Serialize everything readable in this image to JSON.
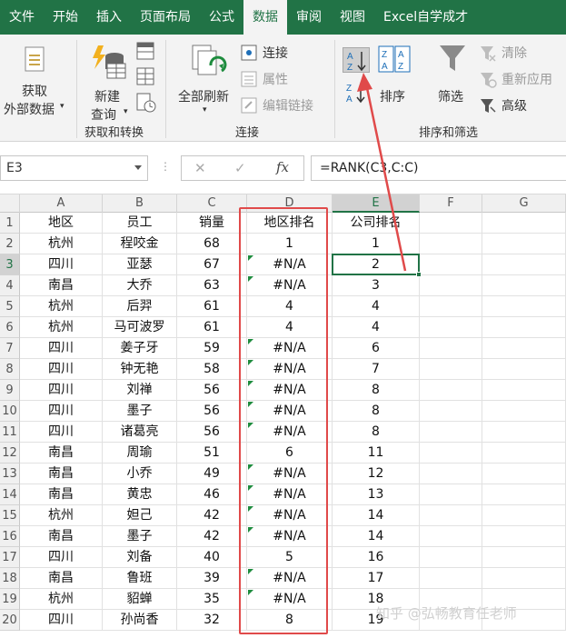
{
  "tabs": [
    {
      "label": "文件",
      "active": false
    },
    {
      "label": "开始",
      "active": false
    },
    {
      "label": "插入",
      "active": false
    },
    {
      "label": "页面布局",
      "active": false
    },
    {
      "label": "公式",
      "active": false
    },
    {
      "label": "数据",
      "active": true
    },
    {
      "label": "审阅",
      "active": false
    },
    {
      "label": "视图",
      "active": false
    },
    {
      "label": "Excel自学成才",
      "active": false
    }
  ],
  "ribbon": {
    "get_external_line1": "获取",
    "get_external_line2": "外部数据",
    "new_query_line1": "新建",
    "new_query_line2": "查询",
    "group_get_transform": "获取和转换",
    "refresh_all": "全部刷新",
    "connections": "连接",
    "properties": "属性",
    "edit_links": "编辑链接",
    "group_connections": "连接",
    "sort": "排序",
    "filter": "筛选",
    "clear": "清除",
    "reapply": "重新应用",
    "advanced": "高级",
    "group_sort_filter": "排序和筛选",
    "accent_color": "#217346",
    "annotation_color": "#e04a4a"
  },
  "formula_bar": {
    "name_box": "E3",
    "cancel_icon": "✕",
    "enter_icon": "✓",
    "fx_label": "fx",
    "formula": "=RANK(C3,C:C)"
  },
  "sheet": {
    "columns": [
      "A",
      "B",
      "C",
      "D",
      "E",
      "F",
      "G"
    ],
    "selected_column": "E",
    "selected_row": 3,
    "header_row": [
      "地区",
      "员工",
      "销量",
      "地区排名",
      "公司排名"
    ],
    "rows": [
      [
        "杭州",
        "程咬金",
        "68",
        "1",
        "1"
      ],
      [
        "四川",
        "亚瑟",
        "67",
        "#N/A",
        "2"
      ],
      [
        "南昌",
        "大乔",
        "63",
        "#N/A",
        "3"
      ],
      [
        "杭州",
        "后羿",
        "61",
        "4",
        "4"
      ],
      [
        "杭州",
        "马可波罗",
        "61",
        "4",
        "4"
      ],
      [
        "四川",
        "姜子牙",
        "59",
        "#N/A",
        "6"
      ],
      [
        "四川",
        "钟无艳",
        "58",
        "#N/A",
        "7"
      ],
      [
        "四川",
        "刘禅",
        "56",
        "#N/A",
        "8"
      ],
      [
        "四川",
        "墨子",
        "56",
        "#N/A",
        "8"
      ],
      [
        "四川",
        "诸葛亮",
        "56",
        "#N/A",
        "8"
      ],
      [
        "南昌",
        "周瑜",
        "51",
        "6",
        "11"
      ],
      [
        "南昌",
        "小乔",
        "49",
        "#N/A",
        "12"
      ],
      [
        "南昌",
        "黄忠",
        "46",
        "#N/A",
        "13"
      ],
      [
        "杭州",
        "妲己",
        "42",
        "#N/A",
        "14"
      ],
      [
        "南昌",
        "墨子",
        "42",
        "#N/A",
        "14"
      ],
      [
        "四川",
        "刘备",
        "40",
        "5",
        "16"
      ],
      [
        "南昌",
        "鲁班",
        "39",
        "#N/A",
        "17"
      ],
      [
        "杭州",
        "貂蝉",
        "35",
        "#N/A",
        "18"
      ],
      [
        "四川",
        "孙尚香",
        "32",
        "8",
        "19"
      ]
    ],
    "error_marked_rows": [
      3,
      4,
      7,
      8,
      9,
      10,
      11,
      13,
      14,
      15,
      16,
      18,
      19
    ]
  },
  "watermark": "知乎 @弘畅教育任老师"
}
